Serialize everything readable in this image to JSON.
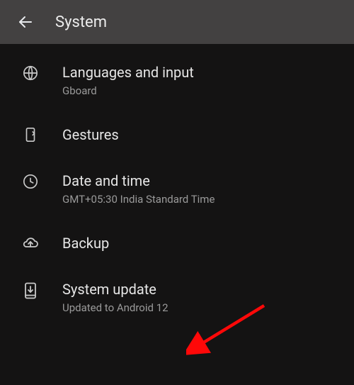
{
  "header": {
    "title": "System"
  },
  "items": [
    {
      "title": "Languages and input",
      "subtitle": "Gboard",
      "icon": "globe-icon",
      "name": "languages-and-input"
    },
    {
      "title": "Gestures",
      "subtitle": null,
      "icon": "gestures-icon",
      "name": "gestures"
    },
    {
      "title": "Date and time",
      "subtitle": "GMT+05:30 India Standard Time",
      "icon": "clock-icon",
      "name": "date-and-time"
    },
    {
      "title": "Backup",
      "subtitle": null,
      "icon": "cloud-upload-icon",
      "name": "backup"
    },
    {
      "title": "System update",
      "subtitle": "Updated to Android 12",
      "icon": "phone-download-icon",
      "name": "system-update"
    }
  ],
  "annotation": {
    "arrow_target": "system-update"
  }
}
